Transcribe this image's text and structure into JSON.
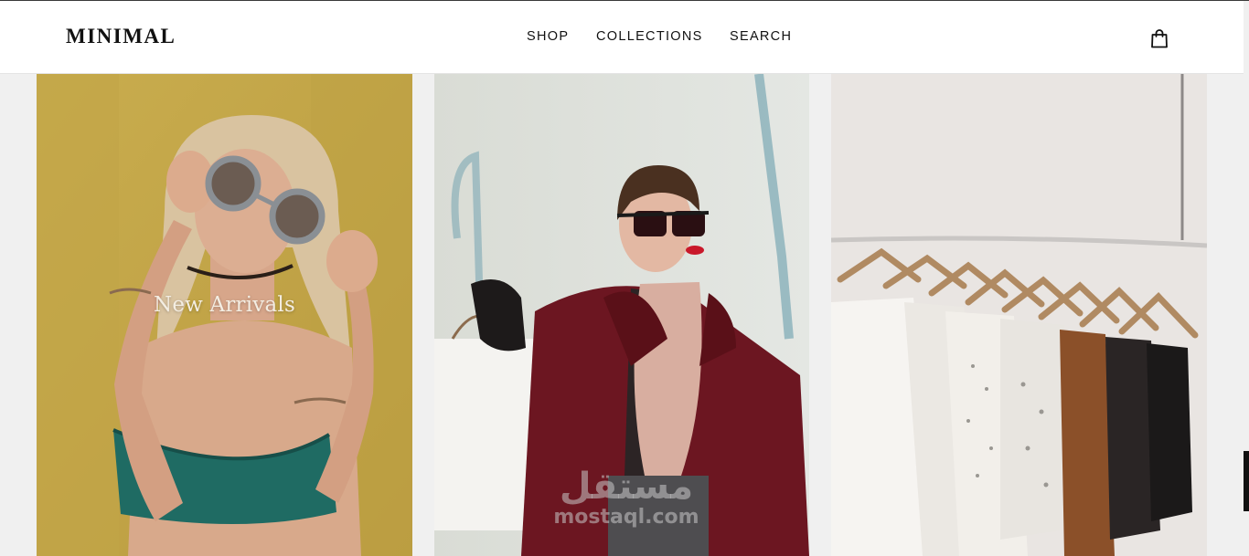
{
  "brand": {
    "logo": "MINIMAL"
  },
  "nav": {
    "items": [
      "SHOP",
      "COLLECTIONS",
      "SEARCH"
    ]
  },
  "header": {
    "cart_icon": "shopping-bag-icon"
  },
  "cards": [
    {
      "caption": "New Arrivals"
    },
    {
      "caption": ""
    },
    {
      "caption": ""
    }
  ],
  "watermark": {
    "arabic": "مستقل",
    "latin": "mostaql.com"
  },
  "colors": {
    "page_bg": "#f0f0f0",
    "header_bg": "#ffffff",
    "text": "#111111",
    "card1_bg": "#c2a84a",
    "card2_bg": "#dfe2dc",
    "card3_bg": "#e8e4e1"
  }
}
